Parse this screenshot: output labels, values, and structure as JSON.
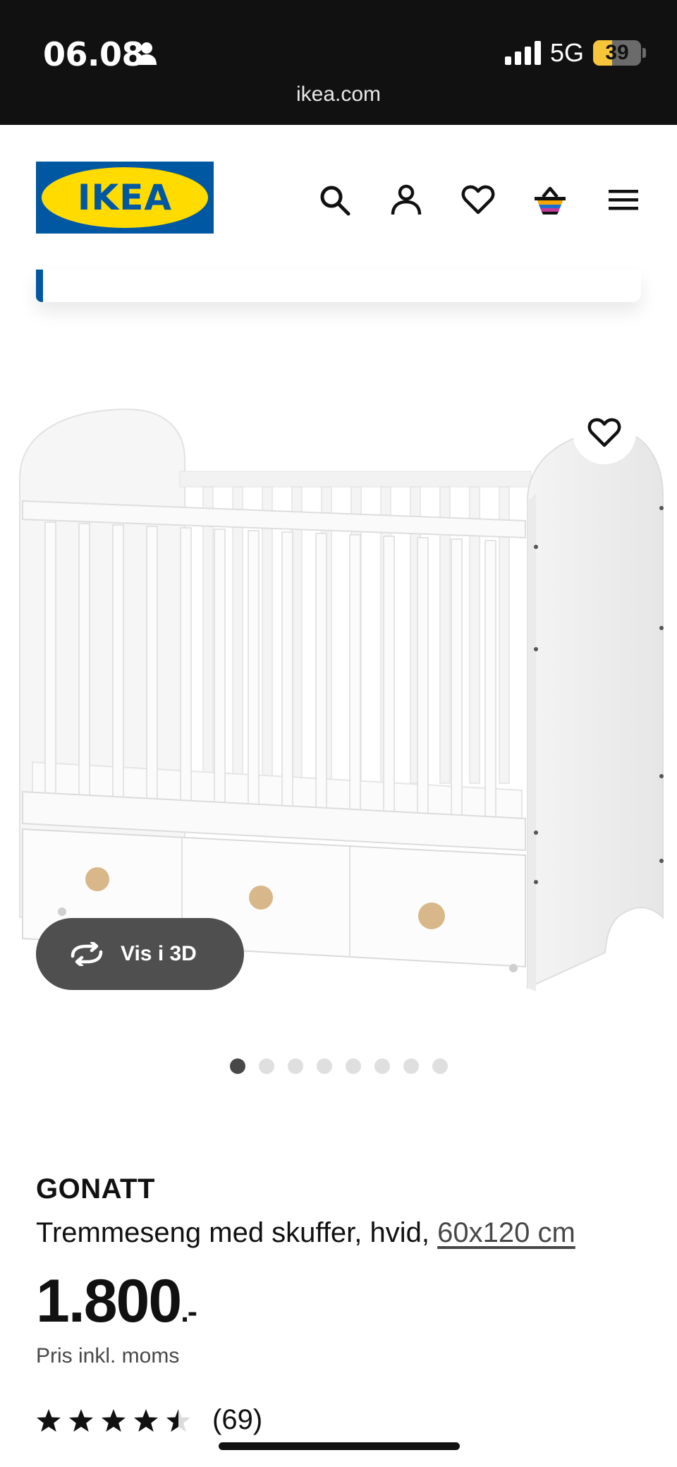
{
  "status_bar": {
    "time": "06.08",
    "network": "5G",
    "battery_level": "39",
    "battery_fraction": 0.39,
    "url": "ikea.com"
  },
  "header": {
    "logo_text": "IKEA",
    "icons": [
      "search-icon",
      "account-icon",
      "favorites-icon",
      "cart-icon",
      "menu-icon"
    ]
  },
  "gallery": {
    "view_3d_label": "Vis i 3D",
    "image_count": 8,
    "active_index": 0
  },
  "product": {
    "name": "GONATT",
    "description": "Tremmeseng med skuffer, hvid, ",
    "size_link": "60x120 cm",
    "price": "1.800",
    "price_suffix": ".-",
    "price_note": "Pris inkl. moms",
    "rating": 4.5,
    "review_count": "(69)"
  },
  "colors": {
    "ikea_blue": "#0058a3",
    "ikea_yellow": "#ffdb00"
  }
}
